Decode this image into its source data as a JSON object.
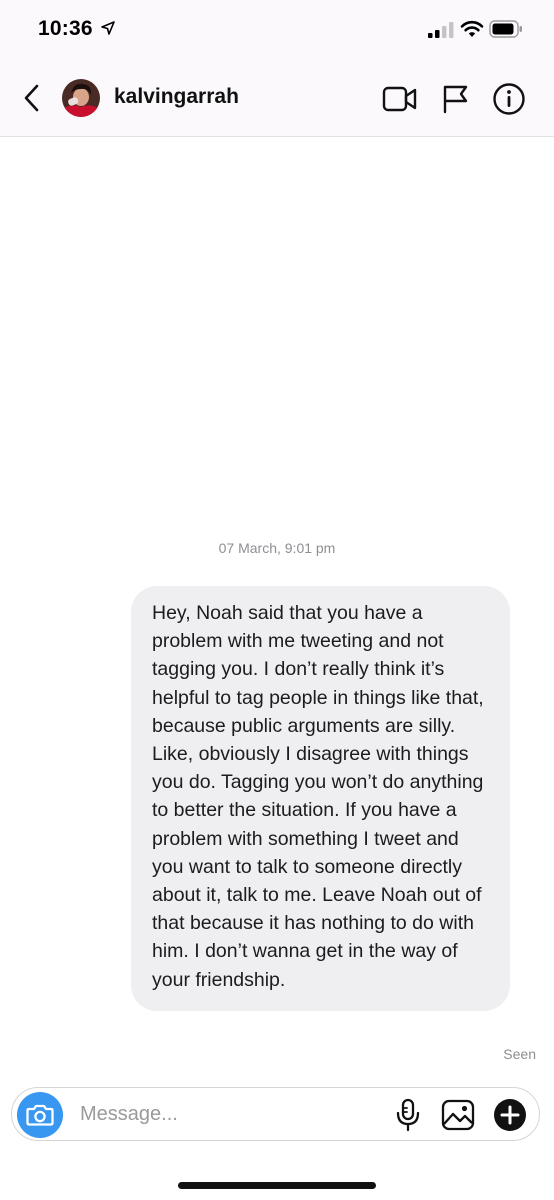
{
  "status_bar": {
    "time": "10:36"
  },
  "header": {
    "username": "kalvingarrah",
    "icons": [
      "back-chevron-icon",
      "video-camera-icon",
      "flag-icon",
      "info-icon"
    ]
  },
  "thread": {
    "timestamp": "07 March, 9:01 pm",
    "messages": [
      {
        "sender": "me",
        "text": "Hey, Noah said that you have a problem with me tweeting and not tagging you. I don’t really think it’s helpful to tag people in things like that, because public arguments are silly. Like, obviously I disagree with things you do. Tagging you won’t do anything to better the situation. If you have a problem with something I tweet and you want to talk to someone directly about it, talk to me. Leave Noah out of that because it has nothing to do with him. I don’t wanna get in the way of your friendship."
      }
    ],
    "seen_label": "Seen"
  },
  "composer": {
    "placeholder": "Message...",
    "value": "",
    "icons": [
      "camera-icon",
      "microphone-icon",
      "gallery-icon",
      "plus-icon"
    ]
  },
  "colors": {
    "accent": "#3897f0",
    "bubble": "#efeef1",
    "meta_text": "#8e8e93"
  }
}
